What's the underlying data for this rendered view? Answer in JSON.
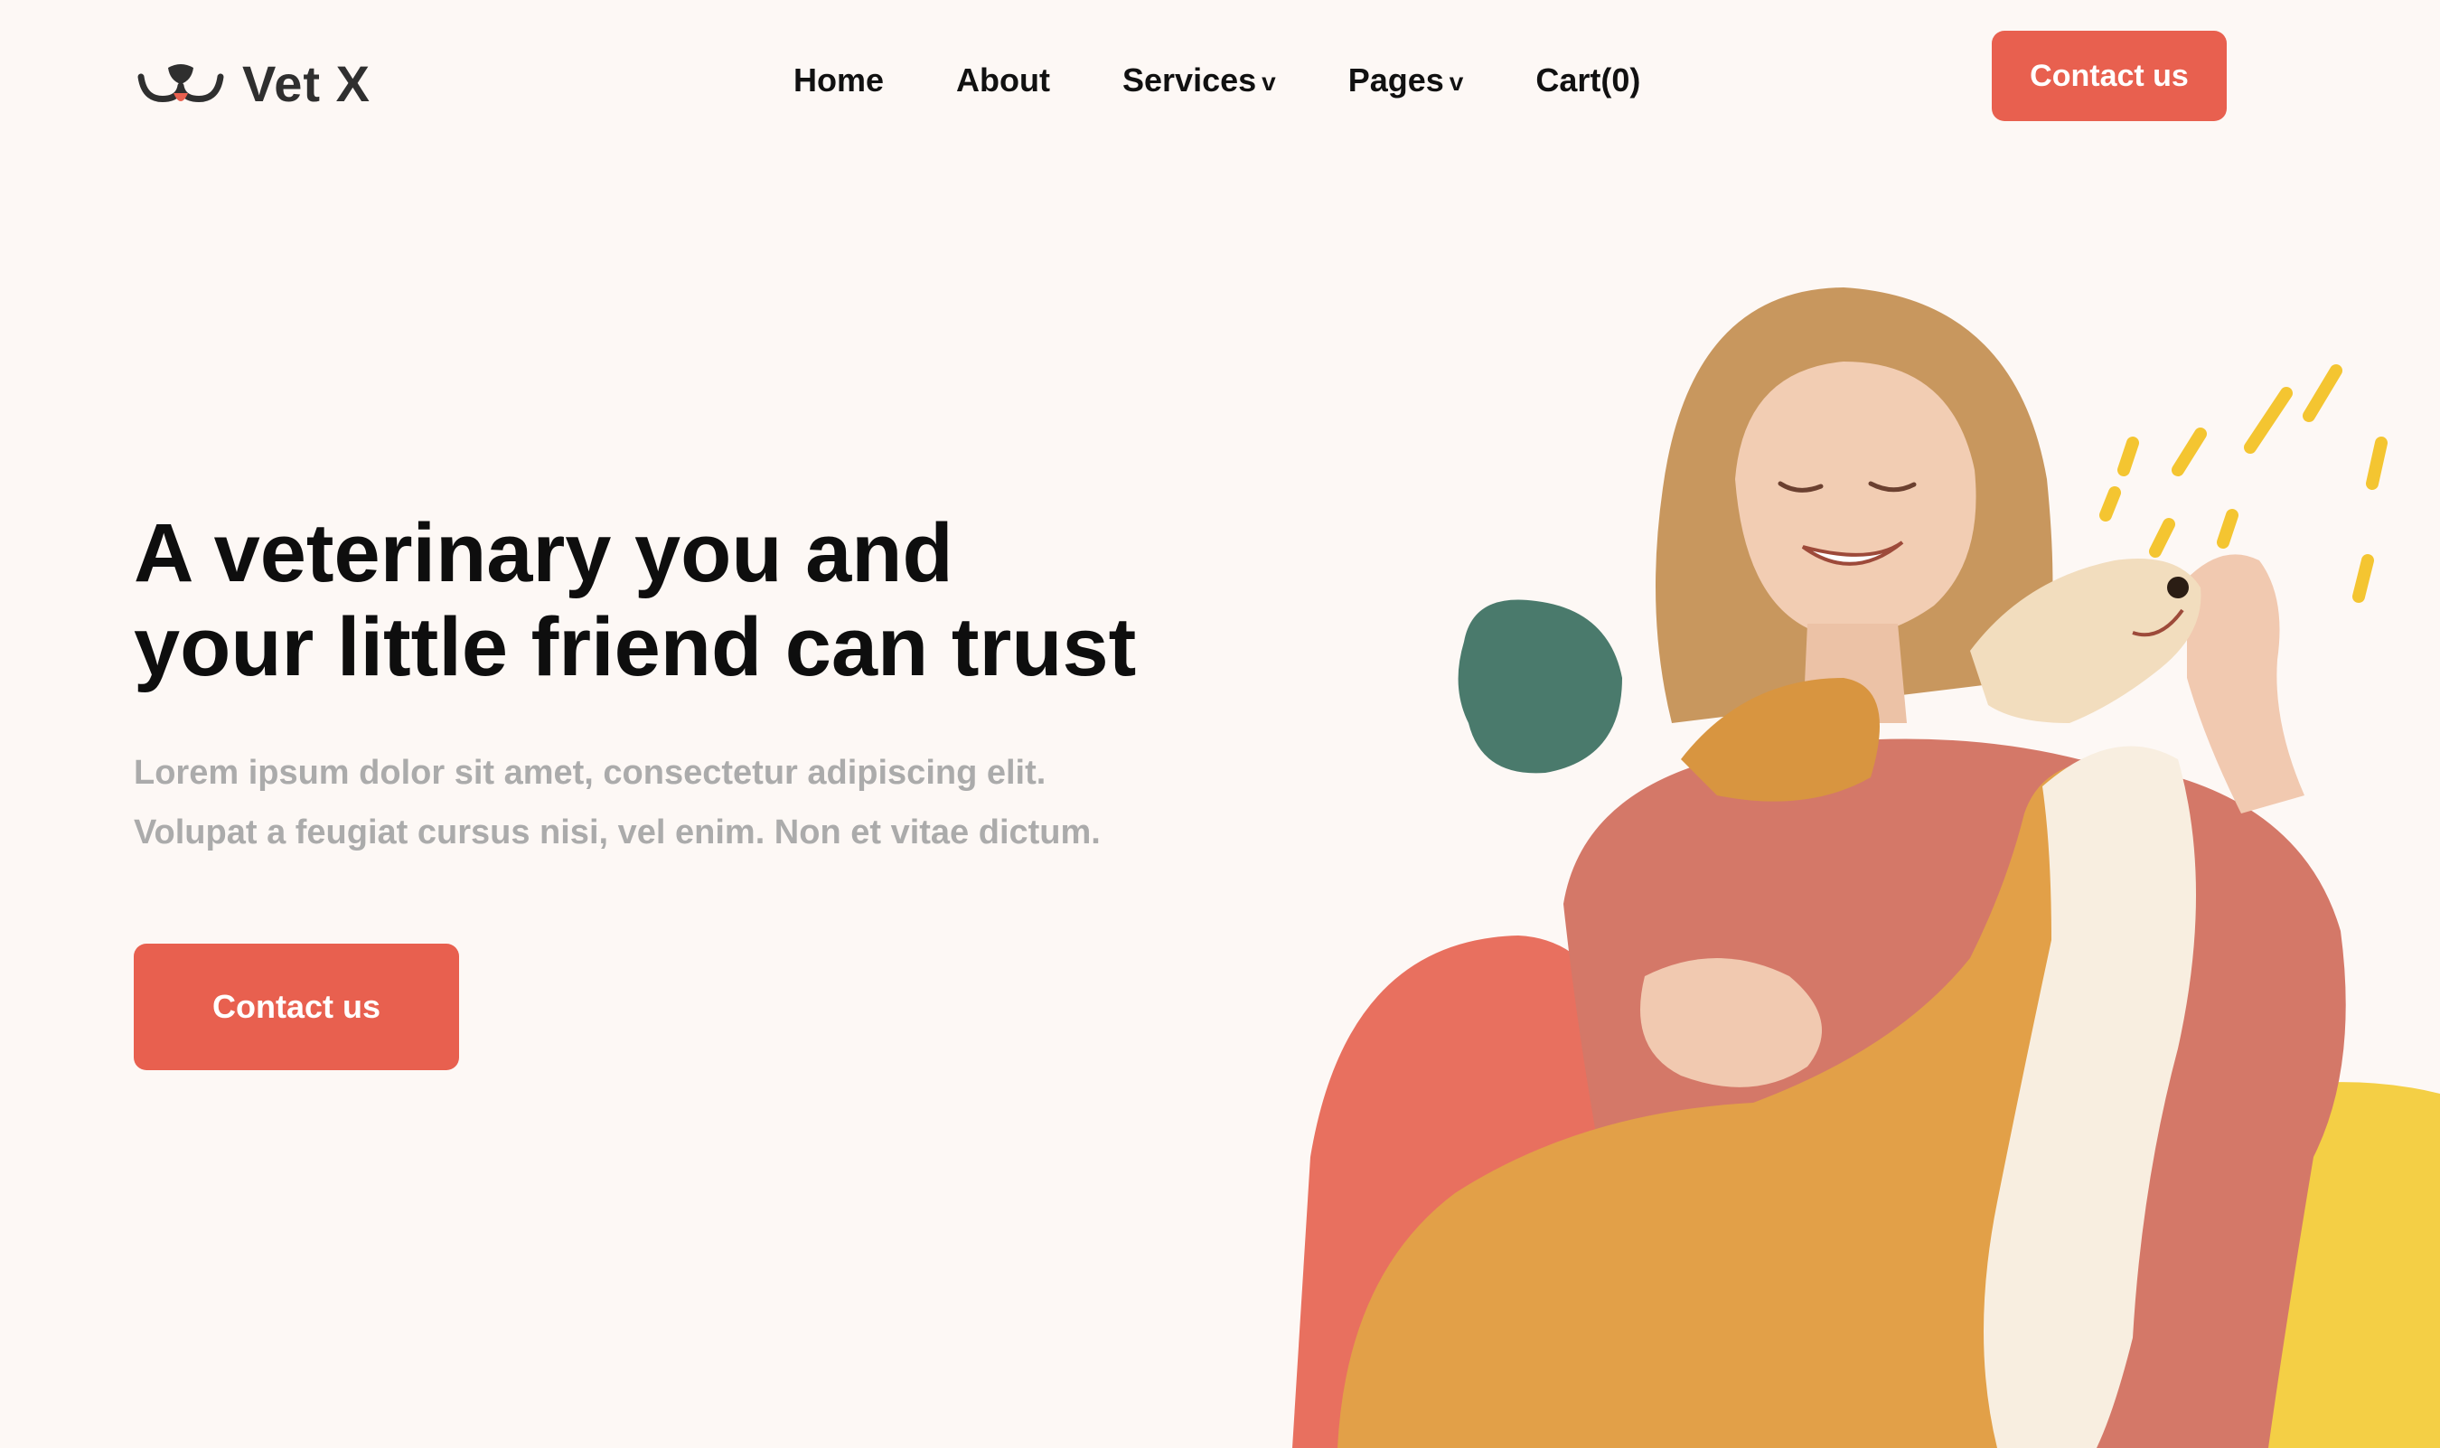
{
  "header": {
    "brand": "Vet X",
    "nav": [
      {
        "label": "Home"
      },
      {
        "label": "About"
      },
      {
        "label": "Services",
        "caret": "v"
      },
      {
        "label": "Pages",
        "caret": "v"
      },
      {
        "label": "Cart(0)"
      }
    ],
    "cta_label": "Contact us"
  },
  "hero": {
    "title_line1": "A veterinary you and",
    "title_line2": "your little friend can trust",
    "subtitle_line1": "Lorem ipsum dolor sit amet, consectetur adipiscing elit.",
    "subtitle_line2": "Volupat a feugiat cursus nisi, vel enim. Non et vitae dictum.",
    "cta_label": "Contact us"
  },
  "colors": {
    "background": "#fdf8f5",
    "accent": "#e8604f",
    "teal_blob": "#4a7a6c",
    "yellow_blob": "#f4cf45",
    "subtitle_text": "#ababab"
  },
  "icons": {
    "logo": "dog-face-logo-icon",
    "dropdown": "chevron-down-icon"
  }
}
